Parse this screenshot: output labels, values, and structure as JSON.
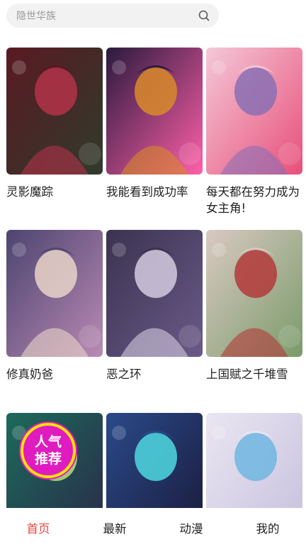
{
  "search": {
    "placeholder": "隐世华族"
  },
  "comics": [
    {
      "title": "灵影魔踪",
      "palette": [
        "#5a1a22",
        "#b3324a",
        "#2f3b2c"
      ]
    },
    {
      "title": "我能看到成功率",
      "palette": [
        "#2a1a3e",
        "#d9892a",
        "#ff5fa8"
      ]
    },
    {
      "title": "每天都在努力成为女主角!",
      "palette": [
        "#f4c8d8",
        "#8a6fb4",
        "#e84f7a"
      ]
    },
    {
      "title": "修真奶爸",
      "palette": [
        "#4c4470",
        "#e9d3c8",
        "#b98ab3"
      ]
    },
    {
      "title": "恶之环",
      "palette": [
        "#3b3350",
        "#d4cbe0",
        "#6a5a88"
      ]
    },
    {
      "title": "上国赋之千堆雪",
      "palette": [
        "#d9c9c2",
        "#b33a3a",
        "#7a9b6a"
      ]
    },
    {
      "title": "",
      "palette": [
        "#1c6a5a",
        "#b8e07a",
        "#2a2a4a"
      ],
      "badge": [
        "人气",
        "推荐"
      ]
    },
    {
      "title": "",
      "palette": [
        "#2a4a8a",
        "#4fd8e0",
        "#1a1a3a"
      ]
    },
    {
      "title": "",
      "palette": [
        "#e9e6f2",
        "#6fb6e0",
        "#c7c0dc"
      ]
    }
  ],
  "tabs": [
    {
      "label": "首页",
      "active": true
    },
    {
      "label": "最新",
      "active": false
    },
    {
      "label": "动漫",
      "active": false
    },
    {
      "label": "我的",
      "active": false
    }
  ],
  "colors": {
    "accent": "#e8453c",
    "search_bg": "#f2f2f2"
  }
}
